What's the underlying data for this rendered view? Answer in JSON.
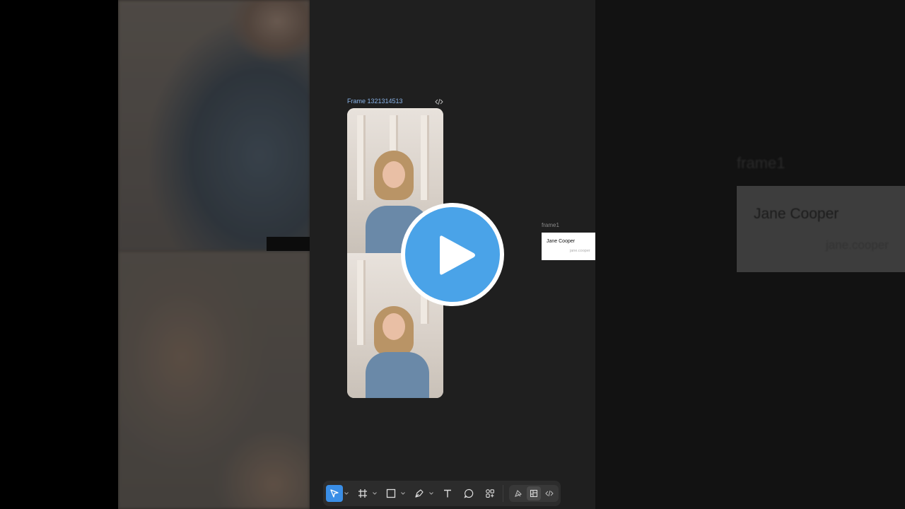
{
  "canvas": {
    "frame_label": "Frame 1321314513",
    "frame_code_icon": "code-icon",
    "card_label": "frame1",
    "card": {
      "name": "Jane Cooper",
      "email": "jane.cooper"
    }
  },
  "ghost_panel": {
    "label": "frame1",
    "name": "Jane Cooper",
    "email": "jane.cooper"
  },
  "overlay": {
    "play_icon": "play-icon"
  },
  "toolbar": {
    "tools": [
      {
        "icon": "cursor-icon",
        "active": true,
        "has_menu": true
      },
      {
        "icon": "frame-icon",
        "active": false,
        "has_menu": true
      },
      {
        "icon": "rectangle-icon",
        "active": false,
        "has_menu": true
      },
      {
        "icon": "pen-icon",
        "active": false,
        "has_menu": true
      },
      {
        "icon": "text-icon",
        "active": false,
        "has_menu": false
      },
      {
        "icon": "comment-icon",
        "active": false,
        "has_menu": false
      },
      {
        "icon": "components-icon",
        "active": false,
        "has_menu": false
      }
    ],
    "modes": [
      {
        "icon": "design-mode-icon",
        "selected": false
      },
      {
        "icon": "dev-layout-icon",
        "selected": true
      },
      {
        "icon": "code-icon",
        "selected": false
      }
    ]
  },
  "colors": {
    "accent": "#3a8ee6",
    "play_fill": "#4aa3e8",
    "canvas_bg": "#1f1f1f",
    "toolbar_bg": "#2c2c2c"
  }
}
